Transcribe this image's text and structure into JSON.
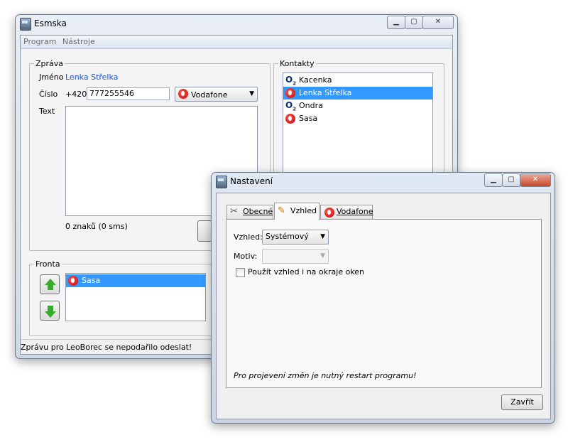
{
  "main_window": {
    "title": "Esmska",
    "menu": [
      "Program",
      "Nástroje"
    ],
    "message_group": "Zpráva",
    "name_label": "Jméno",
    "name_value": "Lenka Střelka",
    "number_label": "Číslo",
    "prefix": "+420",
    "number_value": "777255546",
    "operator": "Vodafone",
    "text_label": "Text",
    "counter": "0 znaků (0 sms)",
    "contacts_group": "Kontakty",
    "contacts": [
      {
        "name": "Kacenka",
        "icon": "o2-icon"
      },
      {
        "name": "Lenka Střelka",
        "icon": "vodafone-icon",
        "selected": true
      },
      {
        "name": "Ondra",
        "icon": "o2-icon"
      },
      {
        "name": "Sasa",
        "icon": "vodafone-icon"
      }
    ],
    "queue_group": "Fronta",
    "queue": [
      {
        "name": "Sasa",
        "icon": "vodafone-icon",
        "selected": true
      }
    ],
    "status": "Zprávu pro LeoBorec se nepodařilo odeslat!"
  },
  "settings_dialog": {
    "title": "Nastavení",
    "tabs": [
      {
        "label": "Obecné",
        "icon": "tools-icon"
      },
      {
        "label": "Vzhled",
        "icon": "palette-icon",
        "active": true
      },
      {
        "label": "Vodafone",
        "icon": "vodafone-icon"
      }
    ],
    "look_label": "Vzhled:",
    "look_value": "Systémový",
    "theme_label": "Motiv:",
    "theme_value": "",
    "checkbox_label": "Použít vzhled i na okraje oken",
    "note": "Pro projevení změn je nutný restart programu!",
    "close_button": "Zavřít"
  },
  "colors": {
    "selection": "#3399ff",
    "link": "#1a4fd1",
    "vodafone": "#d8000b",
    "arrow": "#3aaa2a"
  }
}
